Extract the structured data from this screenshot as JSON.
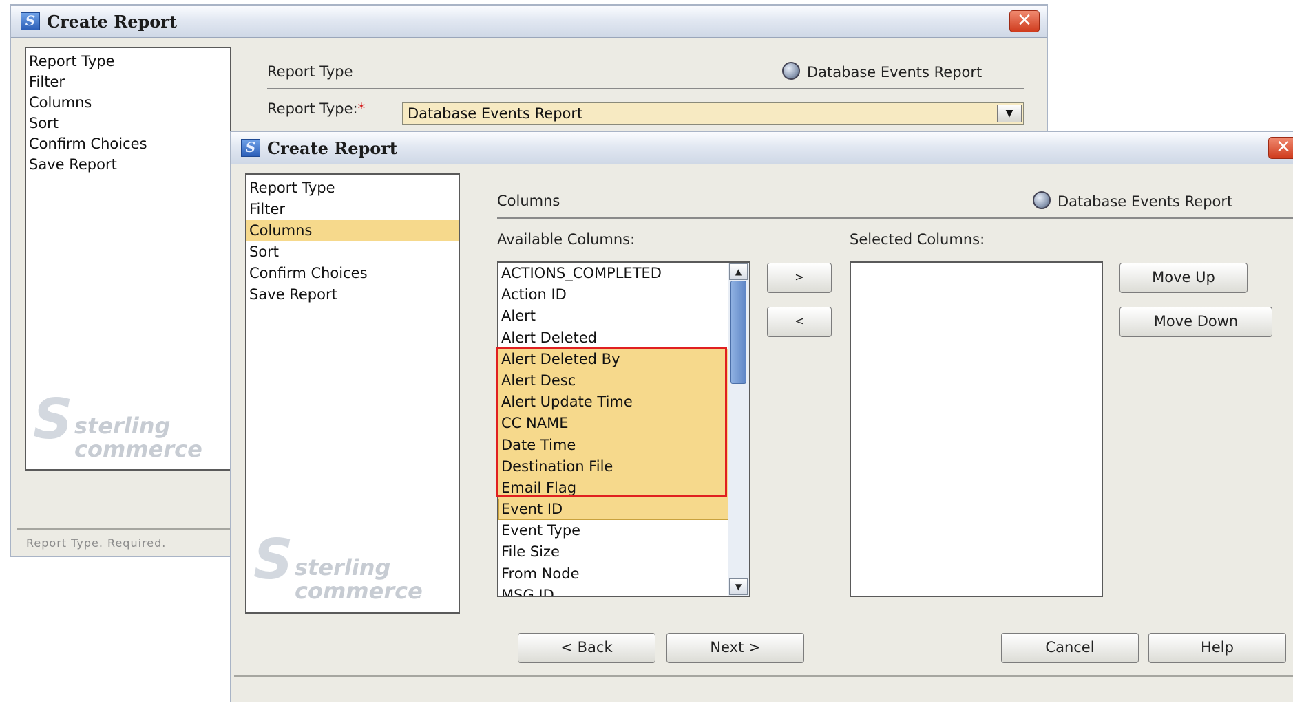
{
  "back_window": {
    "title": "Create Report",
    "nav": [
      "Report Type",
      "Filter",
      "Columns",
      "Sort",
      "Confirm Choices",
      "Save Report"
    ],
    "nav_selected": 0,
    "logo": {
      "line1": "sterling",
      "line2": "commerce"
    },
    "section_title": "Report Type",
    "report_name": "Database Events Report",
    "report_type_label": "Report Type:",
    "required_mark": "*",
    "report_type_value": "Database Events Report",
    "status_text": "Report Type. Required."
  },
  "front_window": {
    "title": "Create Report",
    "nav": [
      "Report Type",
      "Filter",
      "Columns",
      "Sort",
      "Confirm Choices",
      "Save Report"
    ],
    "nav_selected": 2,
    "logo": {
      "line1": "sterling",
      "line2": "commerce"
    },
    "section_title": "Columns",
    "report_name": "Database Events Report",
    "available_label": "Available Columns:",
    "selected_label": "Selected Columns:",
    "available_columns": [
      "ACTIONS_COMPLETED",
      "Action ID",
      "Alert",
      "Alert Deleted",
      "Alert Deleted By",
      "Alert Desc",
      "Alert Update Time",
      "CC NAME",
      "Date Time",
      "Destination File",
      "Email Flag",
      "Event ID",
      "Event Type",
      "File Size",
      "From Node",
      "MSG ID"
    ],
    "highlighted_columns": [
      "Alert Deleted By",
      "Alert Desc",
      "Alert Update Time",
      "CC NAME",
      "Date Time",
      "Destination File",
      "Email Flag",
      "Event ID"
    ],
    "selected_columns": [],
    "add_button": ">",
    "remove_button": "<",
    "move_up": "Move Up",
    "move_down": "Move Down",
    "back_button": "< Back",
    "next_button": "Next >",
    "cancel_button": "Cancel",
    "help_button": "Help"
  },
  "icons": {
    "app": "app-logo-icon",
    "close": "close-icon",
    "report": "globe-report-icon"
  },
  "colors": {
    "selection": "#f6d98c",
    "highlight_border": "#e02020",
    "window_bg": "#ecebe4",
    "close": "#cf3b1d"
  }
}
